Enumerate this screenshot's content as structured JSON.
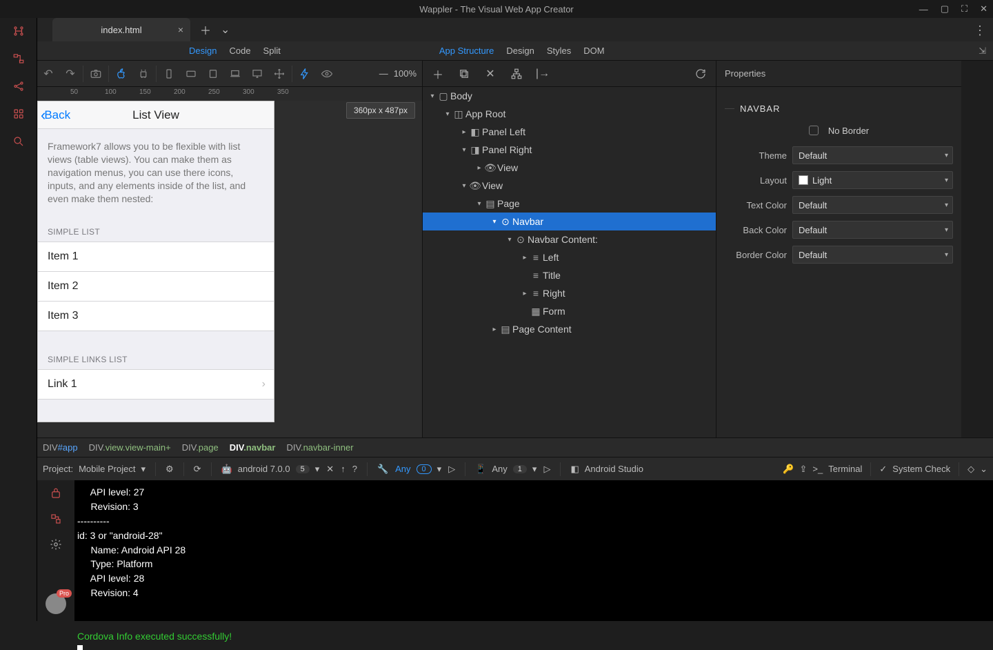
{
  "titlebar": {
    "title": "Wappler - The Visual Web App Creator"
  },
  "tabs": {
    "file": "index.html"
  },
  "subtabs_left": [
    "Design",
    "Code",
    "Split"
  ],
  "subtabs_right": [
    "App Structure",
    "Design",
    "Styles",
    "DOM"
  ],
  "designer": {
    "zoom": "100%",
    "size_badge": "360px x 487px",
    "ruler": [
      "50",
      "100",
      "150",
      "200",
      "250",
      "300",
      "350"
    ],
    "phone": {
      "back": "Back",
      "title": "List View",
      "desc": "Framework7 allows you to be flexible with list views (table views). You can make them as navigation menus, you can use there icons, inputs, and any elements inside of the list, and even make them nested:",
      "head1": "SIMPLE LIST",
      "items": [
        "Item 1",
        "Item 2",
        "Item 3"
      ],
      "head2": "SIMPLE LINKS LIST",
      "link1": "Link 1"
    }
  },
  "tree": {
    "body": "Body",
    "approot": "App Root",
    "panel_left": "Panel Left",
    "panel_right": "Panel Right",
    "view1": "View",
    "view2": "View",
    "page": "Page",
    "navbar": "Navbar",
    "navbar_content": "Navbar Content:",
    "left": "Left",
    "title_node": "Title",
    "right": "Right",
    "form": "Form",
    "page_content": "Page Content"
  },
  "props": {
    "panel_title": "Properties",
    "section": "NAVBAR",
    "no_border": "No Border",
    "theme_label": "Theme",
    "theme": "Default",
    "layout_label": "Layout",
    "layout": "Light",
    "textcolor_label": "Text Color",
    "textcolor": "Default",
    "backcolor_label": "Back Color",
    "backcolor": "Default",
    "bordercolor_label": "Border Color",
    "bordercolor": "Default"
  },
  "breadcrumb": [
    {
      "tag": "DIV",
      "sel": "#app",
      "selclass": "hash"
    },
    {
      "tag": "DIV",
      "sel": ".view.view-main+",
      "selclass": "cls"
    },
    {
      "tag": "DIV",
      "sel": ".page",
      "selclass": "cls"
    },
    {
      "tag": "DIV",
      "sel": ".navbar",
      "selclass": "cls",
      "active": true
    },
    {
      "tag": "DIV",
      "sel": ".navbar-inner",
      "selclass": "cls"
    }
  ],
  "status": {
    "project_label": "Project:",
    "project_name": "Mobile Project",
    "platform": "android 7.0.0",
    "platform_badge": "5",
    "any": "Any",
    "any_badge": "0",
    "device_any": "Any",
    "device_badge": "1",
    "studio": "Android Studio",
    "terminal": "Terminal",
    "syscheck": "System Check"
  },
  "terminal_lines": [
    "     API level: 27",
    "     Revision: 3",
    "----------",
    "id: 3 or \"android-28\"",
    "     Name: Android API 28",
    "     Type: Platform",
    "     API level: 28",
    "     Revision: 4",
    "",
    ""
  ],
  "terminal_success": "Cordova Info executed successfully!",
  "avatar_badge": "Pro"
}
